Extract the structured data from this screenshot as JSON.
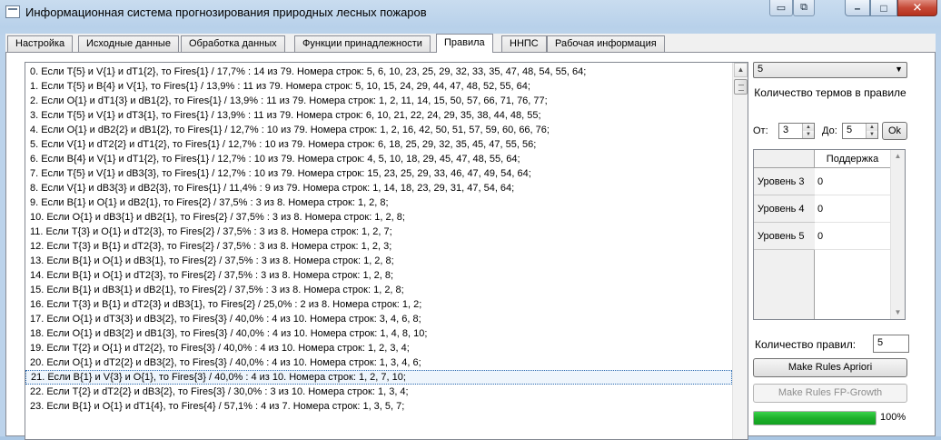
{
  "window": {
    "title": "Информационная система прогнозирования природных лесных пожаров"
  },
  "colors": {
    "progress": "#1eb02b",
    "close_button": "#c64a38",
    "selection_border": "#2b6ab0"
  },
  "tabs": [
    {
      "label": "Настройка"
    },
    {
      "label": "Исходные данные"
    },
    {
      "label": "Обработка данных"
    },
    {
      "label": "Функции принадлежности"
    },
    {
      "label": "Правила",
      "active": true
    },
    {
      "label": "ННПС"
    },
    {
      "label": "Рабочая информация"
    }
  ],
  "rules": [
    "0. Если T{5} и V{1} и dT1{2}, то Fires{1} / 17,7% : 14 из 79. Номера строк: 5, 6, 10, 23, 25, 29, 32, 33, 35, 47, 48, 54, 55, 64;",
    "1. Если T{5} и B{4} и V{1}, то Fires{1} / 13,9% : 11 из 79. Номера строк: 5, 10, 15, 24, 29, 44, 47, 48, 52, 55, 64;",
    "2. Если O{1} и dT1{3} и dB1{2}, то Fires{1} / 13,9% : 11 из 79. Номера строк: 1, 2, 11, 14, 15, 50, 57, 66, 71, 76, 77;",
    "3. Если T{5} и V{1} и dT3{1}, то Fires{1} / 13,9% : 11 из 79. Номера строк: 6, 10, 21, 22, 24, 29, 35, 38, 44, 48, 55;",
    "4. Если O{1} и dB2{2} и dB1{2}, то Fires{1} / 12,7% : 10 из 79. Номера строк: 1, 2, 16, 42, 50, 51, 57, 59, 60, 66, 76;",
    "5. Если V{1} и dT2{2} и dT1{2}, то Fires{1} / 12,7% : 10 из 79. Номера строк: 6, 18, 25, 29, 32, 35, 45, 47, 55, 56;",
    "6. Если B{4} и V{1} и dT1{2}, то Fires{1} / 12,7% : 10 из 79. Номера строк: 4, 5, 10, 18, 29, 45, 47, 48, 55, 64;",
    "7. Если T{5} и V{1} и dB3{3}, то Fires{1} / 12,7% : 10 из 79. Номера строк: 15, 23, 25, 29, 33, 46, 47, 49, 54, 64;",
    "8. Если V{1} и dB3{3} и dB2{3}, то Fires{1} / 11,4% : 9 из 79. Номера строк: 1, 14, 18, 23, 29, 31, 47, 54, 64;",
    "9. Если B{1} и O{1} и dB2{1}, то Fires{2} / 37,5% : 3 из 8. Номера строк: 1, 2, 8;",
    "10. Если O{1} и dB3{1} и dB2{1}, то Fires{2} / 37,5% : 3 из 8. Номера строк: 1, 2, 8;",
    "11. Если T{3} и O{1} и dT2{3}, то Fires{2} / 37,5% : 3 из 8. Номера строк: 1, 2, 7;",
    "12. Если T{3} и B{1} и dT2{3}, то Fires{2} / 37,5% : 3 из 8. Номера строк: 1, 2, 3;",
    "13. Если B{1} и O{1} и dB3{1}, то Fires{2} / 37,5% : 3 из 8. Номера строк: 1, 2, 8;",
    "14. Если B{1} и O{1} и dT2{3}, то Fires{2} / 37,5% : 3 из 8. Номера строк: 1, 2, 8;",
    "15. Если B{1} и dB3{1} и dB2{1}, то Fires{2} / 37,5% : 3 из 8. Номера строк: 1, 2, 8;",
    "16. Если T{3} и B{1} и dT2{3} и dB3{1}, то Fires{2} / 25,0% : 2 из 8. Номера строк: 1, 2;",
    "17. Если O{1} и dT3{3} и dB3{2}, то Fires{3} / 40,0% : 4 из 10. Номера строк: 3, 4, 6, 8;",
    "18. Если O{1} и dB3{2} и dB1{3}, то Fires{3} / 40,0% : 4 из 10. Номера строк: 1, 4, 8, 10;",
    "19. Если T{2} и O{1} и dT2{2}, то Fires{3} / 40,0% : 4 из 10. Номера строк: 1, 2, 3, 4;",
    "20. Если O{1} и dT2{2} и dB3{2}, то Fires{3} / 40,0% : 4 из 10. Номера строк: 1, 3, 4, 6;",
    "21. Если B{1} и V{3} и O{1}, то Fires{3} / 40,0% : 4 из 10. Номера строк: 1, 2, 7, 10;",
    "22. Если T{2} и dT2{2} и dB3{2}, то Fires{3} / 30,0% : 3 из 10. Номера строк: 1, 3, 4;",
    "23. Если B{1} и O{1} и dT1{4}, то Fires{4} / 57,1% : 4 из 7. Номера строк: 1, 3, 5, 7;"
  ],
  "selected_rule_index": 21,
  "right_panel": {
    "combo_value": "5",
    "terms_label": "Количество термов в правиле",
    "from_label": "От:",
    "from_value": "3",
    "to_label": "До:",
    "to_value": "5",
    "ok_label": "Ok",
    "grid": {
      "header": "Поддержка",
      "rows": [
        {
          "label": "Уровень 3",
          "value": "0"
        },
        {
          "label": "Уровень 4",
          "value": "0"
        },
        {
          "label": "Уровень 5",
          "value": "0"
        }
      ]
    },
    "rules_count_label": "Количество правил:",
    "rules_count_value": "5",
    "apriori_button": "Make Rules Apriori",
    "fpgrowth_button": "Make Rules FP-Growth",
    "progress_percent": 100,
    "progress_label": "100%"
  }
}
